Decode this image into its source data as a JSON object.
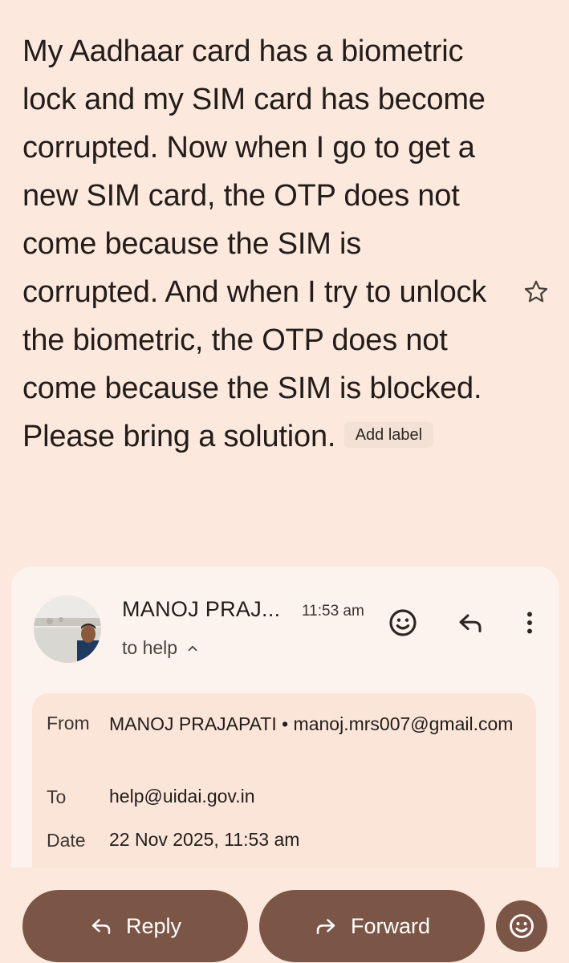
{
  "email": {
    "subject": "My Aadhaar card has a biometric lock and my SIM card has become corrupted. Now when I go to get a new SIM card, the OTP does not come because the SIM is corrupted. And when I try to unlock the biometric, the OTP does not come because the SIM is blocked. Please bring a solution.",
    "add_label": "Add label"
  },
  "message": {
    "sender_name": "MANOJ PRAJ...",
    "time": "11:53 am",
    "recipient_summary": "to help",
    "details": {
      "from_label": "From",
      "from_value": "MANOJ PRAJAPATI • manoj.mrs007@gmail.com",
      "to_label": "To",
      "to_value": "help@uidai.gov.in",
      "date_label": "Date",
      "date_value": "22 Nov 2025, 11:53 am"
    }
  },
  "actions": {
    "reply_label": "Reply",
    "forward_label": "Forward"
  },
  "icons": {
    "star": "star-outline-icon",
    "emoji": "add-reaction-icon",
    "reply": "reply-arrow-icon",
    "more": "more-vert-icon",
    "forward": "forward-arrow-icon",
    "expand": "chevron-up-icon"
  },
  "colors": {
    "background": "#fce8dc",
    "card": "#fdf3ee",
    "details_panel": "#fbe5d9",
    "button": "#7b5646"
  }
}
